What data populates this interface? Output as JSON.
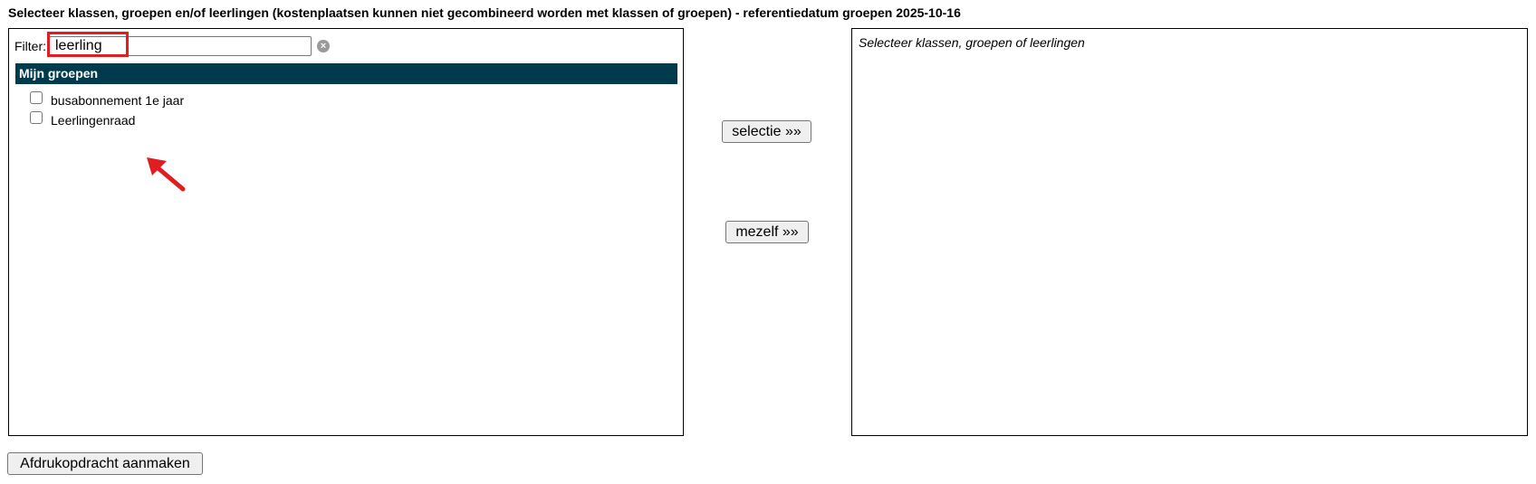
{
  "title": "Selecteer klassen, groepen en/of leerlingen (kostenplaatsen kunnen niet gecombineerd worden met klassen of groepen) - referentiedatum groepen 2025-10-16",
  "filter": {
    "label": "Filter:",
    "value": "leerling",
    "clear_icon": "×"
  },
  "group_header": "Mijn groepen",
  "groups": [
    {
      "label": "busabonnement 1e jaar",
      "checked": false
    },
    {
      "label": "Leerlingenraad",
      "checked": false
    }
  ],
  "buttons": {
    "selectie": "selectie »»",
    "mezelf": "mezelf »»",
    "print": "Afdrukopdracht aanmaken"
  },
  "selection_placeholder": "Selecteer klassen, groepen of leerlingen",
  "colors": {
    "header_bg": "#003b4d",
    "annotation_red": "#e11d21"
  },
  "icons": {
    "clear": "close-icon",
    "annotation": "arrow-icon"
  }
}
